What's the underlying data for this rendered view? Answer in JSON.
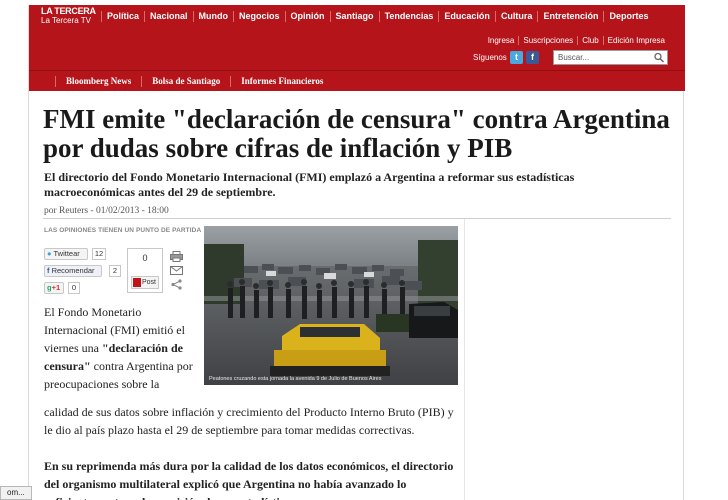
{
  "header": {
    "brand_line1": "LA TERCERA",
    "brand_line2": "La Tercera TV",
    "nav": [
      "Política",
      "Nacional",
      "Mundo",
      "Negocios",
      "Opinión",
      "Santiago",
      "Tendencias",
      "Educación",
      "Cultura",
      "Entretención",
      "Deportes"
    ],
    "utility": [
      "Ingresa",
      "Suscripciones",
      "Club",
      "Edición Impresa"
    ],
    "follow_label": "Síguenos",
    "search_placeholder": "Buscar..."
  },
  "section_nav": [
    "Bloomberg News",
    "Bolsa de Santiago",
    "Informes Financieros"
  ],
  "article": {
    "title": "FMI emite \"declaración de censura\" contra Argentina por dudas sobre cifras de inflación y PIB",
    "lead": "El directorio del Fondo Monetario  Internacional (FMI) emplazó a Argentina a reformar sus estadísticas macroeconómicas antes del 29 de septiembre.",
    "byline": "por Reuters - 01/02/2013 - 18:00",
    "photo_caption": "Peatones cruzando esta jornada la avenida 9 de Julio de Buenos Aires",
    "para1_a": "El Fondo Monetario Internacional (FMI) emitió el viernes una ",
    "para1_b": "\"declaración de censura\"",
    "para1_c": " contra Argentina por preocupaciones sobre la",
    "para2": "calidad de sus datos sobre inflación y crecimiento del Producto Interno Bruto (PIB) y le dio al país plazo hasta el 29 de septiembre para tomar medidas correctivas.",
    "para3": "En su reprimenda más dura por la calidad de los datos económicos, el directorio del organismo multilateral explicó que Argentina no había avanzado lo suficientemente en la precisión de sus estadísticas"
  },
  "share": {
    "title": "LAS OPINIONES TIENEN UN PUNTO DE PARTIDA",
    "twitter_label": "Twittear",
    "twitter_count": "12",
    "facebook_label": "Recomendar",
    "facebook_count": "2",
    "gplus_label": "+1",
    "gplus_count": "0",
    "comments_count": "0",
    "post_label": "Post"
  },
  "status_text": "om..."
}
